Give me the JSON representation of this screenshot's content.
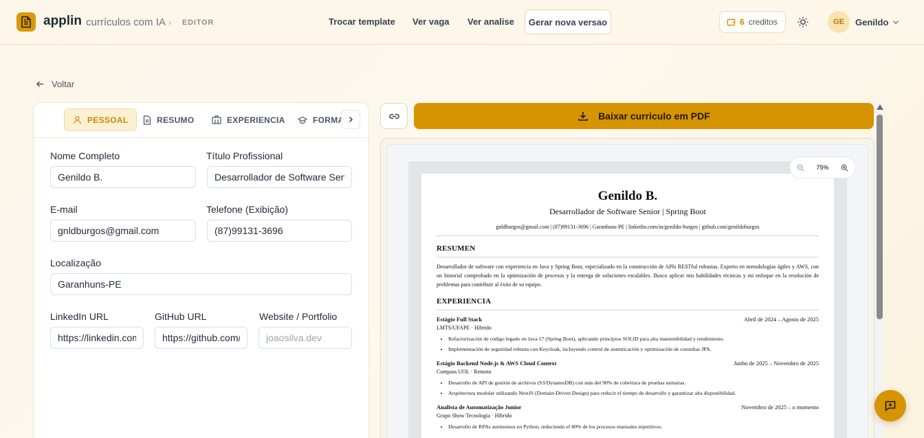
{
  "header": {
    "brand": "applin",
    "brand_sub": "currículos com IA",
    "breadcrumb": "EDITOR",
    "nav": {
      "change_template": "Trocar template",
      "view_job": "Ver vaga",
      "view_analysis": "Ver analise",
      "new_version": "Gerar nova versao"
    },
    "credits": {
      "count": "6",
      "label": "creditos"
    },
    "user": {
      "initials": "GE",
      "name": "Genildo"
    }
  },
  "back_label": "Voltar",
  "tabs": [
    {
      "label": "PESSOAL",
      "icon": "user-icon"
    },
    {
      "label": "RESUMO",
      "icon": "document-icon"
    },
    {
      "label": "EXPERIENCIA",
      "icon": "building-icon"
    },
    {
      "label": "FORMA",
      "icon": "graduation-cap-icon"
    }
  ],
  "form": {
    "full_name": {
      "label": "Nome Completo",
      "value": "Genildo B."
    },
    "title": {
      "label": "Título Profissional",
      "value": "Desarrollador de Software Senior | Spring Boot"
    },
    "email": {
      "label": "E-mail",
      "value": "gnldburgos@gmail.com"
    },
    "phone": {
      "label": "Telefone (Exibição)",
      "value": "(87)99131-3696"
    },
    "location": {
      "label": "Localização",
      "value": "Garanhuns-PE"
    },
    "linkedin": {
      "label": "LinkedIn URL",
      "value": "https://linkedin.com/in/genildo-burgos"
    },
    "github": {
      "label": "GitHub URL",
      "value": "https://github.com/genildoburgos"
    },
    "website": {
      "label": "Website / Portfolio",
      "value": "",
      "placeholder": "joaosilva.dev"
    }
  },
  "pdf_button": "Baixar curriculo em PDF",
  "zoom_level": "75%",
  "resume": {
    "name": "Genildo B.",
    "role": "Desarrollador de Software Senior | Spring Boot",
    "contact": "gnldburgos@gmail.com | (87)99131-3696 | Garanhuns-PE | linkedin.com/in/genildo-burgos | github.com/genildoburgos",
    "summary_heading": "RESUMEN",
    "summary": "Desarrollador de software con experiencia en Java y Spring Boot, especializado en la construcción de APIs RESTful robustas. Experto en metodologías ágiles y AWS, con un historial comprobado en la optimización de procesos y la entrega de soluciones escalables. Busco aplicar mis habilidades técnicas y mi enfoque en la resolución de problemas para contribuir al éxito de su equipo.",
    "experience_heading": "EXPERIENCIA",
    "jobs": [
      {
        "title": "Estágio Full Stack",
        "dates": "Abril de 2024 – Agosto de 2025",
        "company": "LMTS/UFAPE · Híbrido",
        "bullets": [
          "Refactorización de código legado en Java 17 (Spring Boot), aplicando principios SOLID para alta mantenibilidad y rendimiento.",
          "Implementación de seguridad robusta con Keycloak, incluyendo control de autenticación y optimización de consultas JPA."
        ]
      },
      {
        "title": "Estágio Backend Node.js & AWS Cloud Context",
        "dates": "Junho de 2025 – Novembro de 2025",
        "company": "Compass UOL · Remoto",
        "bullets": [
          "Desarrollo de API de gestión de archivos (S3/DynamoDB) con más del 90% de cobertura de pruebas unitarias.",
          "Arquitectura modular utilizando NestJS (Domain-Driven Design) para reducir el tiempo de desarrollo y garantizar alta disponibilidad."
        ]
      },
      {
        "title": "Analista de Automatização Junior",
        "dates": "Novembro de 2025 – o momento",
        "company": "Grupo Show Tecnologia · Híbrido",
        "bullets": [
          "Desarrollo de RPAs autónomos en Python, reduciendo el 80% de los procesos manuales repetitivos."
        ]
      }
    ]
  },
  "colors": {
    "accent": "#d69400",
    "accent_light": "#fcf0d3",
    "background": "#fbf6ea"
  }
}
